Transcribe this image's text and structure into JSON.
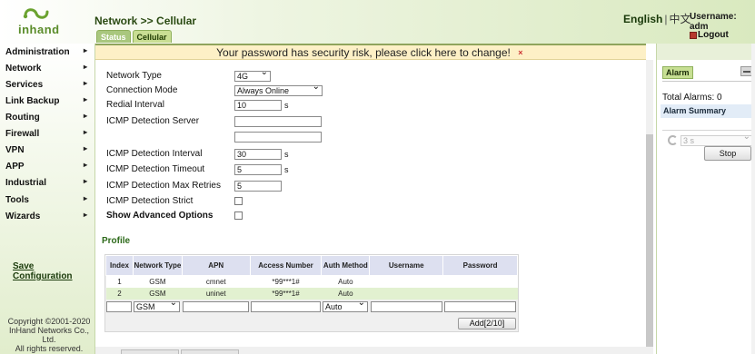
{
  "header": {
    "logo_text": "inhand",
    "breadcrumb": "Network >> Cellular",
    "lang_en": "English",
    "lang_sep": "|",
    "lang_zh": "中文",
    "username": "Username: adm",
    "logout": "Logout",
    "tabs": [
      {
        "label": "Status"
      },
      {
        "label": "Cellular"
      }
    ]
  },
  "sidebar": {
    "items": [
      {
        "label": "Administration"
      },
      {
        "label": "Network"
      },
      {
        "label": "Services"
      },
      {
        "label": "Link Backup"
      },
      {
        "label": "Routing"
      },
      {
        "label": "Firewall"
      },
      {
        "label": "VPN"
      },
      {
        "label": "APP"
      },
      {
        "label": "Industrial"
      },
      {
        "label": "Tools"
      },
      {
        "label": "Wizards"
      }
    ],
    "arrow": "▸",
    "save_config": "Save Configuration",
    "copyright": [
      "Copyright ©2001-2020",
      "InHand Networks Co., Ltd.",
      "All rights reserved."
    ]
  },
  "banner": {
    "text": "Your password has security risk, please click here to change!",
    "close": "×"
  },
  "form": {
    "network_type": {
      "label": "Network Type",
      "value": "4G"
    },
    "connection_mode": {
      "label": "Connection Mode",
      "value": "Always Online"
    },
    "redial_interval": {
      "label": "Redial Interval",
      "value": "10",
      "unit": "s"
    },
    "icmp_server": {
      "label": "ICMP Detection Server",
      "value1": "",
      "value2": ""
    },
    "icmp_interval": {
      "label": "ICMP Detection Interval",
      "value": "30",
      "unit": "s"
    },
    "icmp_timeout": {
      "label": "ICMP Detection Timeout",
      "value": "5",
      "unit": "s"
    },
    "icmp_retries": {
      "label": "ICMP Detection Max Retries",
      "value": "5"
    },
    "icmp_strict": {
      "label": "ICMP Detection Strict",
      "checked": false
    },
    "advanced": {
      "label": "Show Advanced Options",
      "checked": false
    }
  },
  "profile": {
    "title": "Profile",
    "columns": [
      "Index",
      "Network Type",
      "APN",
      "Access Number",
      "Auth Method",
      "Username",
      "Password"
    ],
    "rows": [
      [
        "1",
        "GSM",
        "cmnet",
        "*99***1#",
        "Auto",
        "",
        ""
      ],
      [
        "2",
        "GSM",
        "uninet",
        "*99***1#",
        "Auto",
        "",
        ""
      ]
    ],
    "new_row": {
      "network_type": "GSM",
      "auth": "Auto"
    },
    "add_button": "Add[2/10]"
  },
  "alarm": {
    "tab": "Alarm",
    "total": "Total Alarms: 0",
    "summary": "Alarm Summary",
    "interval": "3 s",
    "stop": "Stop"
  }
}
